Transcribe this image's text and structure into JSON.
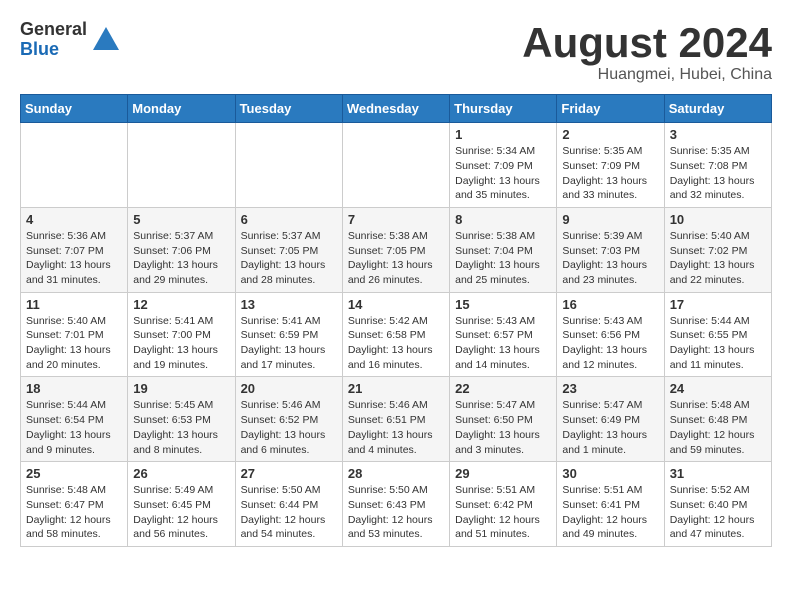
{
  "header": {
    "logo_general": "General",
    "logo_blue": "Blue",
    "month_title": "August 2024",
    "location": "Huangmei, Hubei, China"
  },
  "days_of_week": [
    "Sunday",
    "Monday",
    "Tuesday",
    "Wednesday",
    "Thursday",
    "Friday",
    "Saturday"
  ],
  "weeks": [
    [
      {
        "day": "",
        "info": ""
      },
      {
        "day": "",
        "info": ""
      },
      {
        "day": "",
        "info": ""
      },
      {
        "day": "",
        "info": ""
      },
      {
        "day": "1",
        "info": "Sunrise: 5:34 AM\nSunset: 7:09 PM\nDaylight: 13 hours\nand 35 minutes."
      },
      {
        "day": "2",
        "info": "Sunrise: 5:35 AM\nSunset: 7:09 PM\nDaylight: 13 hours\nand 33 minutes."
      },
      {
        "day": "3",
        "info": "Sunrise: 5:35 AM\nSunset: 7:08 PM\nDaylight: 13 hours\nand 32 minutes."
      }
    ],
    [
      {
        "day": "4",
        "info": "Sunrise: 5:36 AM\nSunset: 7:07 PM\nDaylight: 13 hours\nand 31 minutes."
      },
      {
        "day": "5",
        "info": "Sunrise: 5:37 AM\nSunset: 7:06 PM\nDaylight: 13 hours\nand 29 minutes."
      },
      {
        "day": "6",
        "info": "Sunrise: 5:37 AM\nSunset: 7:05 PM\nDaylight: 13 hours\nand 28 minutes."
      },
      {
        "day": "7",
        "info": "Sunrise: 5:38 AM\nSunset: 7:05 PM\nDaylight: 13 hours\nand 26 minutes."
      },
      {
        "day": "8",
        "info": "Sunrise: 5:38 AM\nSunset: 7:04 PM\nDaylight: 13 hours\nand 25 minutes."
      },
      {
        "day": "9",
        "info": "Sunrise: 5:39 AM\nSunset: 7:03 PM\nDaylight: 13 hours\nand 23 minutes."
      },
      {
        "day": "10",
        "info": "Sunrise: 5:40 AM\nSunset: 7:02 PM\nDaylight: 13 hours\nand 22 minutes."
      }
    ],
    [
      {
        "day": "11",
        "info": "Sunrise: 5:40 AM\nSunset: 7:01 PM\nDaylight: 13 hours\nand 20 minutes."
      },
      {
        "day": "12",
        "info": "Sunrise: 5:41 AM\nSunset: 7:00 PM\nDaylight: 13 hours\nand 19 minutes."
      },
      {
        "day": "13",
        "info": "Sunrise: 5:41 AM\nSunset: 6:59 PM\nDaylight: 13 hours\nand 17 minutes."
      },
      {
        "day": "14",
        "info": "Sunrise: 5:42 AM\nSunset: 6:58 PM\nDaylight: 13 hours\nand 16 minutes."
      },
      {
        "day": "15",
        "info": "Sunrise: 5:43 AM\nSunset: 6:57 PM\nDaylight: 13 hours\nand 14 minutes."
      },
      {
        "day": "16",
        "info": "Sunrise: 5:43 AM\nSunset: 6:56 PM\nDaylight: 13 hours\nand 12 minutes."
      },
      {
        "day": "17",
        "info": "Sunrise: 5:44 AM\nSunset: 6:55 PM\nDaylight: 13 hours\nand 11 minutes."
      }
    ],
    [
      {
        "day": "18",
        "info": "Sunrise: 5:44 AM\nSunset: 6:54 PM\nDaylight: 13 hours\nand 9 minutes."
      },
      {
        "day": "19",
        "info": "Sunrise: 5:45 AM\nSunset: 6:53 PM\nDaylight: 13 hours\nand 8 minutes."
      },
      {
        "day": "20",
        "info": "Sunrise: 5:46 AM\nSunset: 6:52 PM\nDaylight: 13 hours\nand 6 minutes."
      },
      {
        "day": "21",
        "info": "Sunrise: 5:46 AM\nSunset: 6:51 PM\nDaylight: 13 hours\nand 4 minutes."
      },
      {
        "day": "22",
        "info": "Sunrise: 5:47 AM\nSunset: 6:50 PM\nDaylight: 13 hours\nand 3 minutes."
      },
      {
        "day": "23",
        "info": "Sunrise: 5:47 AM\nSunset: 6:49 PM\nDaylight: 13 hours\nand 1 minute."
      },
      {
        "day": "24",
        "info": "Sunrise: 5:48 AM\nSunset: 6:48 PM\nDaylight: 12 hours\nand 59 minutes."
      }
    ],
    [
      {
        "day": "25",
        "info": "Sunrise: 5:48 AM\nSunset: 6:47 PM\nDaylight: 12 hours\nand 58 minutes."
      },
      {
        "day": "26",
        "info": "Sunrise: 5:49 AM\nSunset: 6:45 PM\nDaylight: 12 hours\nand 56 minutes."
      },
      {
        "day": "27",
        "info": "Sunrise: 5:50 AM\nSunset: 6:44 PM\nDaylight: 12 hours\nand 54 minutes."
      },
      {
        "day": "28",
        "info": "Sunrise: 5:50 AM\nSunset: 6:43 PM\nDaylight: 12 hours\nand 53 minutes."
      },
      {
        "day": "29",
        "info": "Sunrise: 5:51 AM\nSunset: 6:42 PM\nDaylight: 12 hours\nand 51 minutes."
      },
      {
        "day": "30",
        "info": "Sunrise: 5:51 AM\nSunset: 6:41 PM\nDaylight: 12 hours\nand 49 minutes."
      },
      {
        "day": "31",
        "info": "Sunrise: 5:52 AM\nSunset: 6:40 PM\nDaylight: 12 hours\nand 47 minutes."
      }
    ]
  ]
}
